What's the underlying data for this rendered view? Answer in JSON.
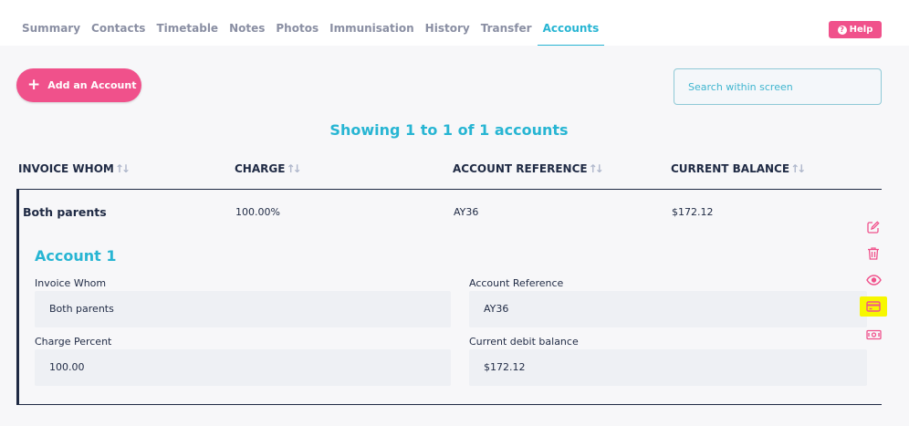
{
  "tabs": [
    {
      "label": "Summary",
      "active": false
    },
    {
      "label": "Contacts",
      "active": false
    },
    {
      "label": "Timetable",
      "active": false
    },
    {
      "label": "Notes",
      "active": false
    },
    {
      "label": "Photos",
      "active": false
    },
    {
      "label": "Immunisation",
      "active": false
    },
    {
      "label": "History",
      "active": false
    },
    {
      "label": "Transfer",
      "active": false
    },
    {
      "label": "Accounts",
      "active": true
    }
  ],
  "help": {
    "label": "Help",
    "icon": "question-circle-icon"
  },
  "toolbar": {
    "add_label": "Add an Account",
    "add_icon": "plus-icon"
  },
  "search": {
    "placeholder": "Search within screen",
    "value": ""
  },
  "summary": {
    "showing": "Showing 1 to 1 of 1 accounts"
  },
  "table": {
    "columns": [
      "INVOICE WHOM",
      "CHARGE",
      "ACCOUNT REFERENCE",
      "CURRENT BALANCE"
    ],
    "sort_icon": "sort-icon",
    "rows": [
      {
        "invoice_whom": "Both parents",
        "charge": "100.00%",
        "account_reference": "AY36",
        "current_balance": "$172.12",
        "detail": {
          "title": "Account 1",
          "invoice_whom_label": "Invoice Whom",
          "invoice_whom_value": "Both parents",
          "account_reference_label": "Account Reference",
          "account_reference_value": "AY36",
          "charge_percent_label": "Charge Percent",
          "charge_percent_value": "100.00",
          "current_debit_balance_label": "Current debit balance",
          "current_debit_balance_value": "$172.12"
        }
      }
    ]
  },
  "row_actions": [
    {
      "icon": "edit-icon",
      "highlighted": false
    },
    {
      "icon": "trash-icon",
      "highlighted": false
    },
    {
      "icon": "eye-icon",
      "highlighted": false
    },
    {
      "icon": "credit-card-icon",
      "highlighted": true
    },
    {
      "icon": "money-icon",
      "highlighted": false
    }
  ],
  "colors": {
    "accent": "#27b5d3",
    "brand_pink": "#f0518b",
    "text": "#1f2a44",
    "highlight": "#f7f700"
  }
}
